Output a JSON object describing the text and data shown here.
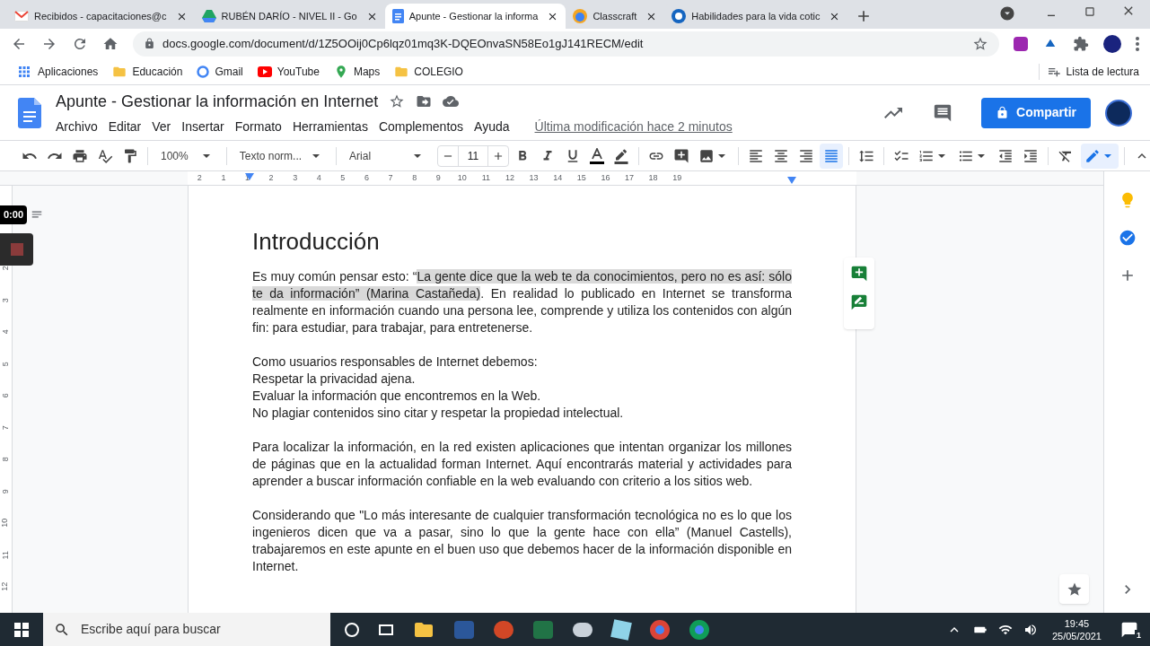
{
  "browser": {
    "tabs": [
      {
        "title": "Recibidos - capacitaciones@c",
        "selected": false
      },
      {
        "title": "RUBÉN DARÍO - NIVEL II - Go",
        "selected": false
      },
      {
        "title": "Apunte - Gestionar la informa",
        "selected": true
      },
      {
        "title": "Classcraft",
        "selected": false
      },
      {
        "title": "Habilidades para la vida cotic",
        "selected": false
      }
    ],
    "url": "docs.google.com/document/d/1Z5OOij0Cp6lqz01mq3K-DQEOnvaSN58Eo1gJ141RECM/edit",
    "bookmarks": [
      "Aplicaciones",
      "Educación",
      "Gmail",
      "YouTube",
      "Maps",
      "COLEGIO"
    ],
    "reading_list": "Lista de lectura"
  },
  "docs": {
    "title": "Apunte - Gestionar la información en Internet",
    "menu": [
      "Archivo",
      "Editar",
      "Ver",
      "Insertar",
      "Formato",
      "Herramientas",
      "Complementos",
      "Ayuda"
    ],
    "last_edit": "Última modificación hace 2 minutos",
    "share": "Compartir",
    "toolbar": {
      "zoom": "100%",
      "style": "Texto norm...",
      "font": "Arial",
      "size": "11",
      "alignments": [
        {
          "kind": "left",
          "selected": false
        },
        {
          "kind": "center",
          "selected": false
        },
        {
          "kind": "right",
          "selected": false
        },
        {
          "kind": "justify",
          "selected": true
        }
      ]
    },
    "ruler": [
      "2",
      "1",
      "1",
      "2",
      "3",
      "4",
      "5",
      "6",
      "7",
      "8",
      "9",
      "10",
      "11",
      "12",
      "13",
      "14",
      "15",
      "16",
      "17",
      "18",
      "19"
    ],
    "vertical_ruler": [
      "2",
      "3",
      "4",
      "5",
      "6",
      "7",
      "8",
      "9",
      "10",
      "11",
      "12"
    ],
    "recording_time": "0:00",
    "document": {
      "heading": "Introducción",
      "sections": [
        [
          [
            {
              "text": "Es muy común pensar esto: “",
              "highlighted": false
            },
            {
              "text": "La gente dice que la web te da conocimientos, pero no es así: sólo te da información” (Marina Castañeda)",
              "highlighted": true
            },
            {
              "text": ". En realidad lo publicado en Internet se transforma realmente en información cuando una persona lee, comprende y utiliza los contenidos con algún fin: para estudiar, para trabajar, para entretenerse.",
              "highlighted": false
            }
          ]
        ],
        [
          [
            {
              "text": "Como usuarios responsables de Internet debemos:",
              "highlighted": false
            }
          ],
          [
            {
              "text": "Respetar la privacidad ajena.",
              "highlighted": false
            }
          ],
          [
            {
              "text": "Evaluar la información que encontremos en la Web.",
              "highlighted": false
            }
          ],
          [
            {
              "text": "No plagiar contenidos sino citar y respetar la propiedad intelectual.",
              "highlighted": false
            }
          ]
        ],
        [
          [
            {
              "text": "Para localizar la información, en la red existen aplicaciones que intentan organizar los millones de páginas que en la actualidad forman Internet. Aquí encontrarás material y actividades para aprender a buscar información confiable en la web evaluando con criterio a los sitios web.",
              "highlighted": false
            }
          ]
        ],
        [
          [
            {
              "text": "Considerando que \"Lo más interesante de cualquier transformación tecnológica no es lo que los ingenieros dicen que va a pasar, sino lo que la gente hace con ella” (Manuel Castells), trabajaremos en este apunte en el buen uso que debemos hacer de la información disponible en Internet.",
              "highlighted": false
            }
          ]
        ]
      ]
    }
  },
  "taskbar": {
    "search_placeholder": "Escribe aquí para buscar",
    "time": "19:45",
    "date": "25/05/2021",
    "notifications": "1"
  }
}
